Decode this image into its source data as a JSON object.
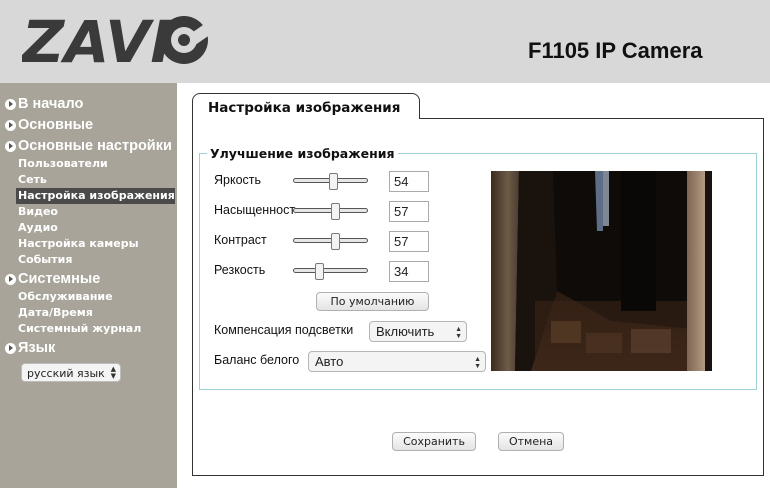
{
  "header": {
    "logo_text": "ZAVIO",
    "model": "F1105 IP Camera",
    "colors": {
      "bar": "#d8d8d8",
      "logo": "#3a3a3a"
    }
  },
  "sidebar": {
    "sections": [
      {
        "label": "В начало",
        "items": []
      },
      {
        "label": "Основные",
        "items": []
      },
      {
        "label": "Основные настройки",
        "items": [
          "Пользователи",
          "Сеть",
          "Настройка изображения",
          "Видео",
          "Аудио",
          "Настройка камеры",
          "События"
        ]
      },
      {
        "label": "Системные",
        "items": [
          "Обслуживание",
          "Дата/Время",
          "Системный журнал"
        ]
      },
      {
        "label": "Язык",
        "items": []
      }
    ],
    "active_item": "Настройка изображения",
    "language": "русский язык",
    "colors": {
      "background": "#a8a499",
      "active": "#4a4a4a"
    }
  },
  "tab": {
    "title": "Настройка изображения"
  },
  "group": {
    "legend": "Улучшение изображения",
    "sliders": [
      {
        "label": "Яркость",
        "value": "54",
        "level": 0.54
      },
      {
        "label": "Насыщенность",
        "value": "57",
        "level": 0.57
      },
      {
        "label": "Контраст",
        "value": "57",
        "level": 0.57
      },
      {
        "label": "Резкость",
        "value": "34",
        "level": 0.34
      }
    ],
    "default_button": "По умолчанию",
    "backlight": {
      "label": "Компенсация подсветки",
      "value": "Включить"
    },
    "white_balance": {
      "label": "Баланс белого",
      "value": "Авто"
    }
  },
  "actions": {
    "save": "Сохранить",
    "cancel": "Отмена"
  }
}
